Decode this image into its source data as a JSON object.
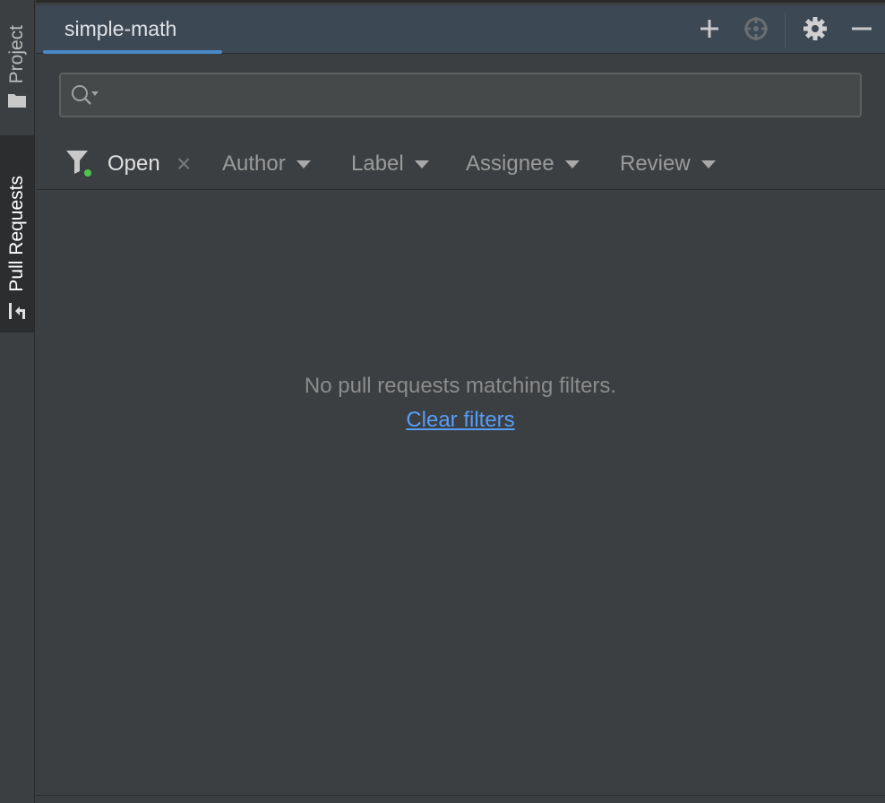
{
  "stripe": {
    "project_label": "Project",
    "pull_requests_label": "Pull Requests"
  },
  "header": {
    "tab_label": "simple-math",
    "icons": [
      "add-icon",
      "locate-icon",
      "gear-icon",
      "minimize-icon"
    ]
  },
  "search": {
    "value": "",
    "placeholder": ""
  },
  "filters": {
    "state_label": "Open",
    "author_label": "Author",
    "label_label": "Label",
    "assignee_label": "Assignee",
    "review_label": "Review"
  },
  "empty": {
    "message": "No pull requests matching filters.",
    "link": "Clear filters"
  },
  "colors": {
    "background": "#3c3f41",
    "header_bg": "#3d4855",
    "accent": "#4a88c7",
    "link": "#589df6",
    "filter_dot": "#4ec64e"
  }
}
